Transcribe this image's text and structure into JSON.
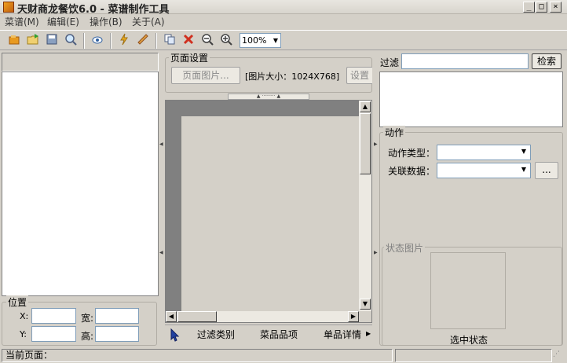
{
  "window": {
    "title": "天财商龙餐饮6.0 - 菜谱制作工具",
    "min_glyph": "_",
    "max_glyph": "□",
    "close_glyph": "×"
  },
  "menu": [
    "菜谱(M)",
    "编辑(E)",
    "操作(B)",
    "关于(A)"
  ],
  "toolbar": {
    "icons": [
      "new-icon",
      "open-icon",
      "save-icon",
      "preview-icon",
      "eye-icon",
      "lightning-icon",
      "ruler-icon",
      "copy-icon",
      "delete-icon",
      "zoom-out-icon",
      "zoom-in-icon"
    ],
    "zoom_value": "100%"
  },
  "page_settings": {
    "group_label": "页面设置",
    "image_button": "页面图片...",
    "image_size": "[图片大小：1024X768]",
    "settings_button": "设置"
  },
  "position": {
    "group_label": "位置",
    "x_label": "X:",
    "y_label": "Y:",
    "width_label": "宽:",
    "height_label": "高:"
  },
  "canvas_tabs": {
    "tab1": "过滤类别",
    "tab2": "菜品品项",
    "tab3": "单品详情"
  },
  "filter": {
    "label": "过滤",
    "search_button": "检索"
  },
  "action": {
    "group_label": "动作",
    "type_label": "动作类型：",
    "data_label": "关联数据：",
    "browse_button": "..."
  },
  "state_image": {
    "group_label": "状态图片",
    "caption": "选中状态"
  },
  "status": {
    "current_page": "当前页面："
  }
}
